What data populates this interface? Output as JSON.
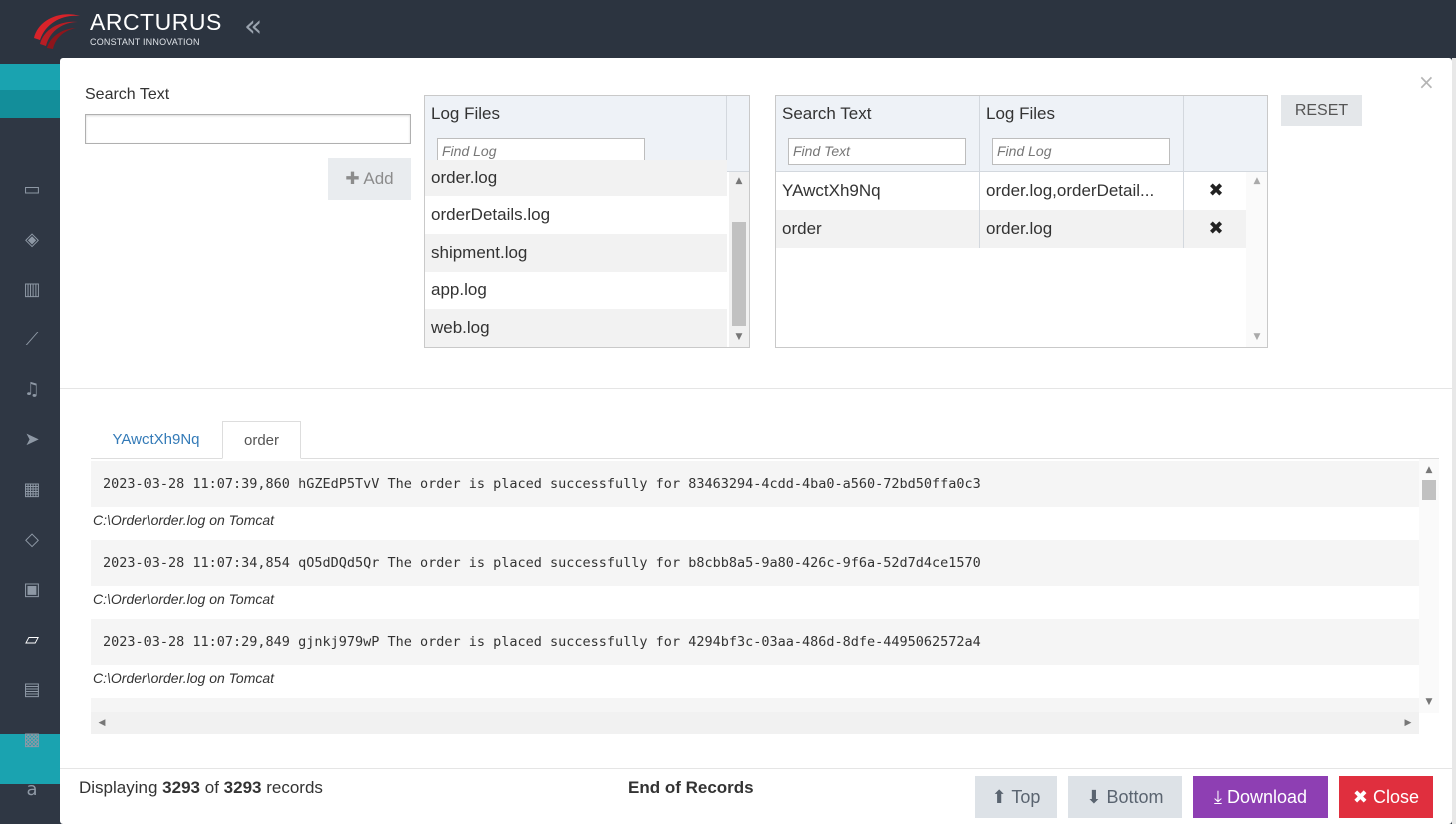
{
  "app": {
    "brand_name": "ARCTURUS",
    "brand_tagline": "CONSTANT INNOVATION",
    "collapse_glyph": "«",
    "icons": [
      "dashboard-icon",
      "layers-icon",
      "bar-chart-icon",
      "line-chart-icon",
      "bell-icon",
      "send-icon",
      "calendar-icon",
      "tag-icon",
      "briefcase-icon",
      "folder-icon",
      "book-icon",
      "grid-icon",
      "amazon-icon"
    ]
  },
  "modal": {
    "close_glyph": "×",
    "search": {
      "label": "Search Text",
      "value": "",
      "add_label": "Add"
    },
    "log_files_panel": {
      "header": "Log Files",
      "filter_placeholder": "Find Log",
      "items": [
        "order.log",
        "orderDetails.log",
        "shipment.log",
        "app.log",
        "web.log"
      ]
    },
    "criteria_panel": {
      "col_search_text": "Search Text",
      "col_log_files": "Log Files",
      "search_placeholder": "Find Text",
      "log_placeholder": "Find Log",
      "rows": [
        {
          "search_text": "YAwctXh9Nq",
          "log_files": "order.log,orderDetail..."
        },
        {
          "search_text": "order",
          "log_files": "order.log"
        }
      ]
    },
    "reset_label": "RESET",
    "tabs": [
      {
        "label": "YAwctXh9Nq",
        "active": false
      },
      {
        "label": "order",
        "active": true
      }
    ],
    "results": [
      {
        "line": "2023-03-28 11:07:39,860 hGZEdP5TvV The order is placed successfully for 83463294-4cdd-4ba0-a560-72bd50ffa0c3",
        "source": "C:\\Order\\order.log on Tomcat"
      },
      {
        "line": "2023-03-28 11:07:34,854 qO5dDQd5Qr The order is placed successfully for b8cbb8a5-9a80-426c-9f6a-52d7d4ce1570",
        "source": "C:\\Order\\order.log on Tomcat"
      },
      {
        "line": "2023-03-28 11:07:29,849 gjnkj979wP The order is placed successfully for 4294bf3c-03aa-486d-8dfe-4495062572a4",
        "source": "C:\\Order\\order.log on Tomcat"
      }
    ],
    "footer": {
      "displaying_prefix": "Displaying",
      "displayed": "3293",
      "of_word": "of",
      "total": "3293",
      "records_word": "records",
      "end_of_records": "End of Records",
      "top_label": "Top",
      "bottom_label": "Bottom",
      "download_label": "Download",
      "close_label": "Close"
    }
  }
}
